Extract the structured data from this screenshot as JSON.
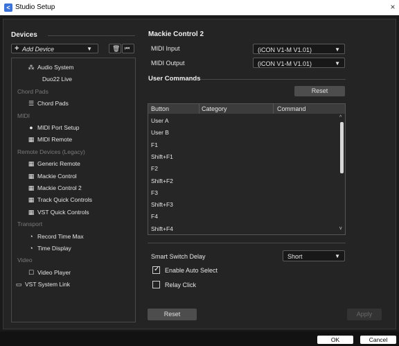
{
  "window": {
    "title": "Studio Setup",
    "close_glyph": "×",
    "app_icon": "<"
  },
  "devices": {
    "title": "Devices",
    "add_device": "Add Device",
    "items": [
      {
        "type": "item",
        "label": "Audio System",
        "icon": "audio-system-icon",
        "glyph": "⁂",
        "indent": 1
      },
      {
        "type": "item",
        "label": "Duo22 Live",
        "icon": "",
        "glyph": "",
        "indent": 2
      },
      {
        "type": "cat",
        "label": "Chord Pads"
      },
      {
        "type": "item",
        "label": "Chord Pads",
        "icon": "chord-pads-icon",
        "glyph": "☰",
        "indent": 2
      },
      {
        "type": "cat",
        "label": "MIDI"
      },
      {
        "type": "item",
        "label": "MIDI Port Setup",
        "icon": "midi-port-icon",
        "glyph": "●",
        "indent": 2
      },
      {
        "type": "item",
        "label": "MIDI Remote",
        "icon": "midi-remote-icon",
        "glyph": "▦",
        "indent": 2
      },
      {
        "type": "cat",
        "label": "Remote Devices (Legacy)"
      },
      {
        "type": "item",
        "label": "Generic Remote",
        "icon": "generic-remote-icon",
        "glyph": "▦",
        "indent": 2
      },
      {
        "type": "item",
        "label": "Mackie Control",
        "icon": "mackie-control-icon",
        "glyph": "▦",
        "indent": 2
      },
      {
        "type": "item",
        "label": "Mackie Control 2",
        "icon": "mackie-control-2-icon",
        "glyph": "▦",
        "indent": 2
      },
      {
        "type": "item",
        "label": "Track Quick Controls",
        "icon": "track-quick-controls-icon",
        "glyph": "▦",
        "indent": 2
      },
      {
        "type": "item",
        "label": "VST Quick Controls",
        "icon": "vst-quick-controls-icon",
        "glyph": "▦",
        "indent": 2
      },
      {
        "type": "cat",
        "label": "Transport"
      },
      {
        "type": "item",
        "label": "Record Time Max",
        "icon": "record-time-icon",
        "glyph": "◔",
        "indent": 2
      },
      {
        "type": "item",
        "label": "Time Display",
        "icon": "time-display-icon",
        "glyph": "◔",
        "indent": 2
      },
      {
        "type": "cat",
        "label": "Video"
      },
      {
        "type": "item",
        "label": "Video Player",
        "icon": "video-player-icon",
        "glyph": "☐",
        "indent": 2
      },
      {
        "type": "item",
        "label": "VST System Link",
        "icon": "vst-system-link-icon",
        "glyph": "▭",
        "indent": 0
      }
    ],
    "reset": "Reset"
  },
  "mackie": {
    "title": "Mackie Control 2",
    "midi_input_label": "MIDI Input",
    "midi_input_value": "(iCON V1-M V1.01)",
    "midi_output_label": "MIDI Output",
    "midi_output_value": "(iCON V1-M V1.01)",
    "user_commands_title": "User Commands",
    "reset": "Reset",
    "table": {
      "columns": [
        "Button",
        "Category",
        "Command"
      ],
      "rows": [
        "User A",
        "User B",
        "F1",
        "Shift+F1",
        "F2",
        "Shift+F2",
        "F3",
        "Shift+F3",
        "F4",
        "Shift+F4"
      ]
    },
    "smart_switch_label": "Smart Switch Delay",
    "smart_switch_value": "Short",
    "enable_auto_select": "Enable Auto Select",
    "enable_auto_select_checked": true,
    "relay_click": "Relay Click",
    "relay_click_checked": false,
    "apply": "Apply"
  },
  "footer": {
    "ok": "OK",
    "cancel": "Cancel"
  }
}
